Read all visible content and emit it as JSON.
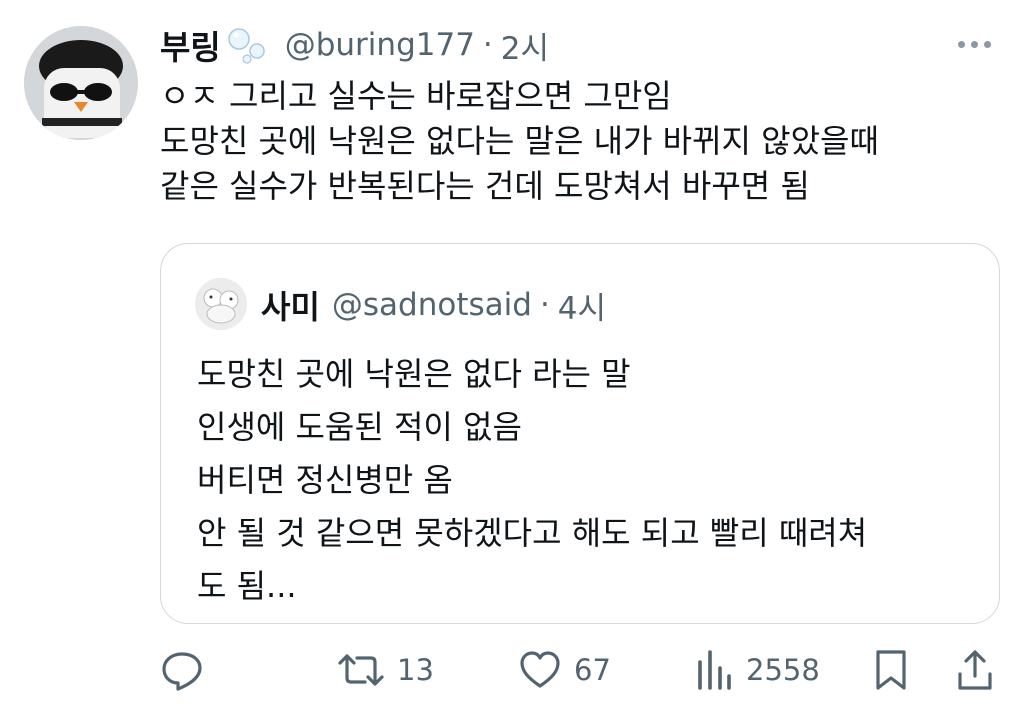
{
  "tweet": {
    "author_name": "부링",
    "handle": "@buring177",
    "separator": "·",
    "time": "2시",
    "lines": [
      "ㅇㅈ 그리고 실수는 바로잡으면 그만임",
      "도망친 곳에 낙원은 없다는 말은 내가 바뀌지 않았을때",
      "같은 실수가 반복된다는 건데 도망쳐서 바꾸면 됨"
    ]
  },
  "quote": {
    "author_name": "사미",
    "handle": "@sadnotsaid",
    "separator": "·",
    "time": "4시",
    "lines": [
      "도망친 곳에 낙원은 없다 라는 말",
      "인생에 도움된 적이 없음",
      "버티면 정신병만 옴",
      "안 될 것 같으면 못하겠다고 해도 되고 빨리 때려쳐",
      "도 됨..."
    ]
  },
  "actions": {
    "reply_count": "",
    "retweet_count": "13",
    "like_count": "67",
    "view_count": "2558"
  },
  "icons": {
    "more": "more-dots-icon",
    "reply": "reply-icon",
    "retweet": "retweet-icon",
    "like": "heart-icon",
    "views": "views-chart-icon",
    "bookmark": "bookmark-icon",
    "share": "share-icon"
  },
  "colors": {
    "text": "#0f1419",
    "secondary": "#536471",
    "border": "#cfd9de"
  }
}
